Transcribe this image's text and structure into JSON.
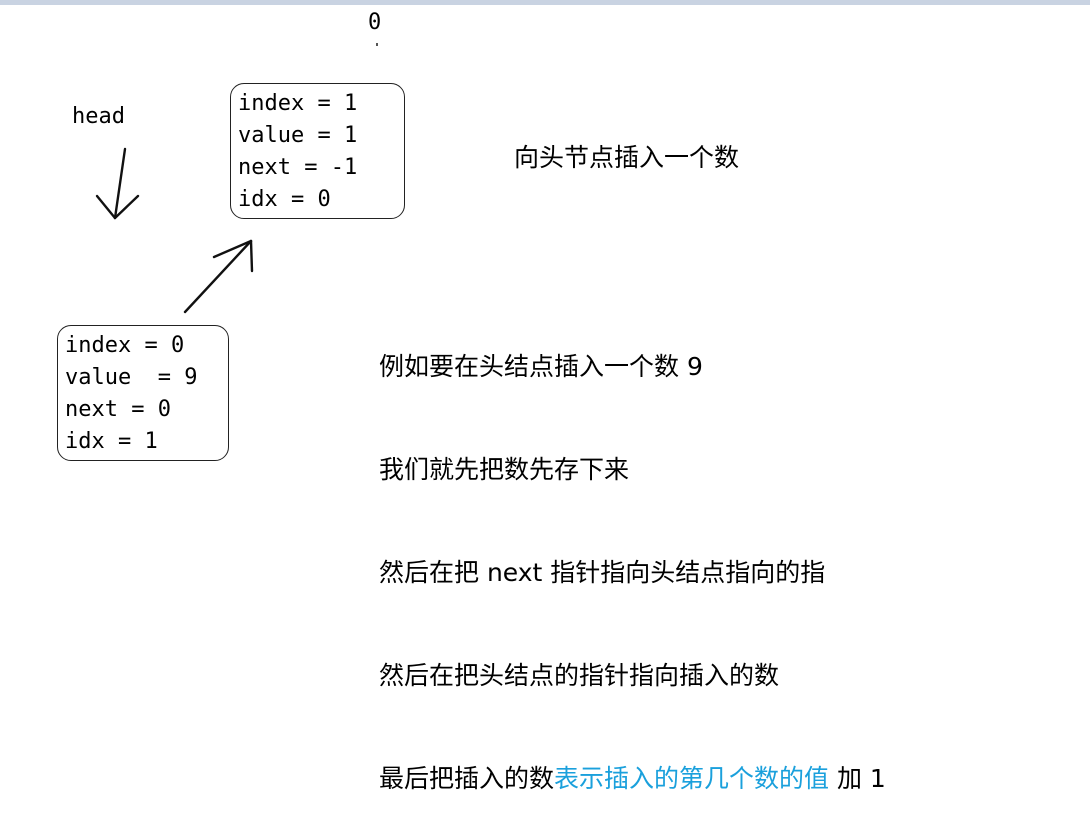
{
  "top_index_label": "0",
  "head_label": "head",
  "nodes": {
    "first": {
      "rows": [
        "index = 1",
        "value = 1",
        "next = -1",
        "idx = 0"
      ]
    },
    "second": {
      "rows": [
        "index = 0",
        "value  = 9",
        "next = 0",
        "idx = 1"
      ]
    }
  },
  "title_note": "向头节点插入一个数",
  "notes": {
    "line1": "例如要在头结点插入一个数 9",
    "line2": "我们就先把数先存下来",
    "line3": "然后在把 next 指针指向头结点指向的指",
    "line4": "然后在把头结点的指针指向插入的数",
    "line5_prefix": "最后把插入的数",
    "line5_highlight": "表示插入的第几个数的值",
    "line5_suffix": " 加 1"
  },
  "colors": {
    "highlight": "#1aa0dc",
    "topbar": "#c9d3e2"
  }
}
